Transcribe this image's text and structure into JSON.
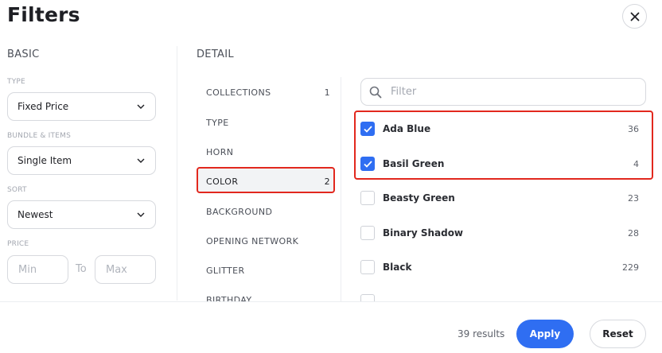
{
  "title": "Filters",
  "basic": {
    "heading": "BASIC",
    "type_label": "TYPE",
    "type_value": "Fixed Price",
    "bundle_label": "BUNDLE & ITEMS",
    "bundle_value": "Single Item",
    "sort_label": "SORT",
    "sort_value": "Newest",
    "price_label": "PRICE",
    "min_placeholder": "Min",
    "to_text": "To",
    "max_placeholder": "Max"
  },
  "detail": {
    "heading": "DETAIL",
    "categories": [
      {
        "label": "COLLECTIONS",
        "count": "1"
      },
      {
        "label": "TYPE",
        "count": ""
      },
      {
        "label": "HORN",
        "count": ""
      },
      {
        "label": "COLOR",
        "count": "2"
      },
      {
        "label": "BACKGROUND",
        "count": ""
      },
      {
        "label": "OPENING NETWORK",
        "count": ""
      },
      {
        "label": "GLITTER",
        "count": ""
      },
      {
        "label": "BIRTHDAY",
        "count": ""
      }
    ],
    "selected_category": "COLOR"
  },
  "filter_search": {
    "placeholder": "Filter"
  },
  "colors": [
    {
      "name": "Ada Blue",
      "count": "36",
      "checked": true
    },
    {
      "name": "Basil Green",
      "count": "4",
      "checked": true
    },
    {
      "name": "Beasty Green",
      "count": "23",
      "checked": false
    },
    {
      "name": "Binary Shadow",
      "count": "28",
      "checked": false
    },
    {
      "name": "Black",
      "count": "229",
      "checked": false
    }
  ],
  "footer": {
    "results": "39 results",
    "apply_label": "Apply",
    "reset_label": "Reset"
  },
  "accent_color": "#2f6ef2",
  "highlight_color": "#e2281e"
}
